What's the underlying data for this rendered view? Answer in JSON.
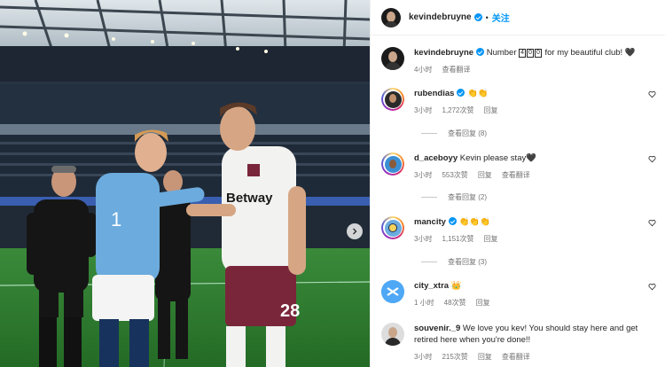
{
  "header": {
    "username": "kevindebruyne",
    "follow_label": "关注",
    "dot": "•"
  },
  "caption": {
    "username": "kevindebruyne",
    "text_before": "Number",
    "digits": [
      "4",
      "0",
      "0"
    ],
    "text_after": "for my beautiful club!",
    "emoji": "🖤",
    "time": "4小时",
    "translate": "查看翻译"
  },
  "comments": [
    {
      "username": "rubendias",
      "text": "👏👏",
      "time": "3小时",
      "likes": "1,272次赞",
      "reply": "回复",
      "translate": "",
      "view_replies": "查看回复 (8)"
    },
    {
      "username": "d_aceboyy",
      "text": "Kevin please stay🖤",
      "time": "3小时",
      "likes": "553次赞",
      "reply": "回复",
      "translate": "查看翻译",
      "view_replies": "查看回复 (2)"
    },
    {
      "username": "mancity",
      "text": "👏👏👏",
      "time": "3小时",
      "likes": "1,151次赞",
      "reply": "回复",
      "translate": "",
      "view_replies": "查看回复 (3)"
    },
    {
      "username": "city_xtra",
      "text": "👑",
      "time": "1 小时",
      "likes": "48次赞",
      "reply": "回复",
      "translate": "",
      "view_replies": ""
    },
    {
      "username": "souvenir._9",
      "text": "We love you kev! You should stay here and get retired here when you're done!!",
      "time": "3小时",
      "likes": "215次赞",
      "reply": "回复",
      "translate": "查看翻译",
      "view_replies": ""
    }
  ],
  "photo": {
    "sponsor": "Betway",
    "shirt_number": "28",
    "sleeve_number": "1"
  },
  "colors": {
    "accent": "#0095f6",
    "city_blue": "#6cabdd",
    "westham_claret": "#7a263a"
  }
}
